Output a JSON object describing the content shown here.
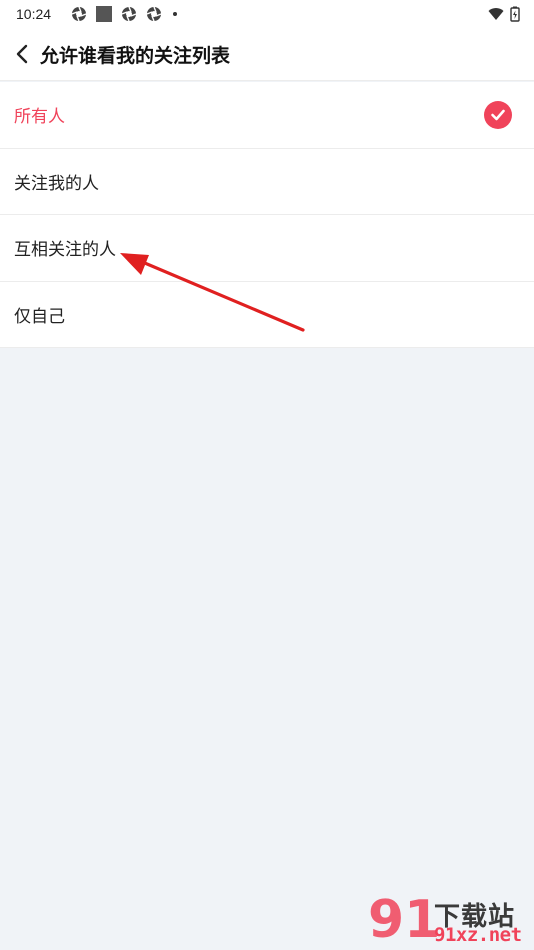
{
  "status_bar": {
    "time": "10:24",
    "left_icons": [
      "aperture-icon",
      "square-icon",
      "aperture-icon",
      "aperture-icon",
      "dot-icon"
    ],
    "right_icons": [
      "wifi-icon",
      "battery-charging-icon"
    ]
  },
  "header": {
    "back_icon": "chevron-left-icon",
    "title": "允许谁看我的关注列表"
  },
  "options": [
    {
      "label": "所有人",
      "selected": true
    },
    {
      "label": "关注我的人",
      "selected": false
    },
    {
      "label": "互相关注的人",
      "selected": false
    },
    {
      "label": "仅自己",
      "selected": false
    }
  ],
  "annotation": {
    "type": "red-arrow",
    "color": "#e02020",
    "points_to": "互相关注的人"
  },
  "watermark": {
    "big": "91",
    "title": "下载站",
    "url": "91xz.net"
  },
  "colors": {
    "accent": "#f0435a",
    "background": "#f0f3f7"
  }
}
